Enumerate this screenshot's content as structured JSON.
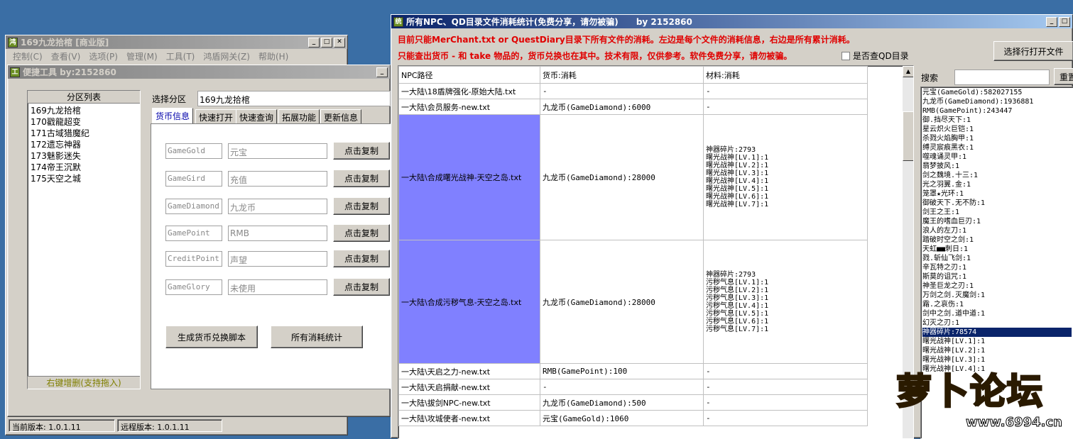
{
  "main_window": {
    "title": "169九龙拾棺 [商业版]",
    "menu": [
      "控制(C)",
      "查看(V)",
      "选项(P)",
      "管理(M)",
      "工具(T)",
      "鸿盾网关(Z)",
      "帮助(H)"
    ],
    "status_current": "当前版本: 1.0.1.11",
    "status_remote": "远程版本: 1.0.1.11"
  },
  "tools_window": {
    "title": "便捷工具  by:2152860",
    "partition_header": "分区列表",
    "partitions": [
      "169九龙拾棺",
      "170戳龍超变",
      "171古域猎魔纪",
      "172遗忘神器",
      "173魅影迷失",
      "174帝王沉默",
      "175天空之城"
    ],
    "partition_footer": "右键增删(支持拖入)",
    "select_label": "选择分区",
    "select_value": "169九龙拾棺",
    "tabs": [
      "货币信息",
      "快速打开",
      "快速查询",
      "拓展功能",
      "更新信息"
    ],
    "currencies": [
      {
        "code": "GameGold",
        "name": "元宝",
        "button": "点击复制"
      },
      {
        "code": "GameGird",
        "name": "充值",
        "button": "点击复制"
      },
      {
        "code": "GameDiamond",
        "name": "九龙币",
        "button": "点击复制"
      },
      {
        "code": "GamePoint",
        "name": "RMB",
        "button": "点击复制"
      },
      {
        "code": "CreditPoint",
        "name": "声望",
        "button": "点击复制"
      },
      {
        "code": "GameGlory",
        "name": "未使用",
        "button": "点击复制"
      }
    ],
    "gen_button": "生成货币兑换脚本",
    "stats_button": "所有消耗统计"
  },
  "stats_window": {
    "title": "所有NPC、QD目录文件消耗统计(免费分享，请勿被骗)      by 2152860",
    "notice1": "目前只能MerChant.txt or QuestDiary目录下所有文件的消耗。左边是每个文件的消耗信息，右边是所有累计消耗。",
    "notice2": "只能查出货币 - 和 take 物品的，货币兑换也在其中。技术有限，仅供参考。软件免费分享，请勿被骗。",
    "qd_checkbox": "是否查QD目录",
    "open_file_button": "选择行打开文件",
    "search_label": "搜索",
    "reset_button": "重置",
    "columns": [
      "NPC路径",
      "货币:消耗",
      "材料:消耗"
    ],
    "rows": [
      {
        "path": "一大陆\\18盾牌强化-原始大陆.txt",
        "currency": "-",
        "materials": [
          "-"
        ]
      },
      {
        "path": "一大陆\\会员服务-new.txt",
        "currency": "九龙币(GameDiamond):6000",
        "materials": [
          "-"
        ]
      },
      {
        "path": "一大陆\\合成曙光战神-天空之岛.txt",
        "currency": "九龙币(GameDiamond):28000",
        "materials": [
          "神器碎片:2793",
          "曙光战神[LV.1]:1",
          "曙光战神[LV.2]:1",
          "曙光战神[LV.3]:1",
          "曙光战神[LV.4]:1",
          "曙光战神[LV.5]:1",
          "曙光战神[LV.6]:1",
          "曙光战神[LV.7]:1"
        ]
      },
      {
        "path": "一大陆\\合成污秽气息-天空之岛.txt",
        "currency": "九龙币(GameDiamond):28000",
        "materials": [
          "神器碎片:2793",
          "污秽气息[LV.1]:1",
          "污秽气息[LV.2]:1",
          "污秽气息[LV.3]:1",
          "污秽气息[LV.4]:1",
          "污秽气息[LV.5]:1",
          "污秽气息[LV.6]:1",
          "污秽气息[LV.7]:1"
        ]
      },
      {
        "path": "一大陆\\天启之力-new.txt",
        "currency": "RMB(GamePoint):100",
        "materials": [
          "-"
        ]
      },
      {
        "path": "一大陆\\天启捐献-new.txt",
        "currency": "-",
        "materials": [
          "-"
        ]
      },
      {
        "path": "一大陆\\拔剑NPC-new.txt",
        "currency": "九龙币(GameDiamond):500",
        "materials": [
          "-"
        ]
      },
      {
        "path": "一大陆\\攻城使者-new.txt",
        "currency": "元宝(GameGold):1060",
        "materials": [
          "-"
        ]
      }
    ],
    "totals": [
      "元宝(GameGold):582027155",
      "九龙币(GameDiamond):1936881",
      "RMB(GamePoint):243447",
      "御.挡尽天下:1",
      "星云炽火巨铠:1",
      "杀戮火焰胸甲:1",
      "缚灵宸痕黑衣:1",
      "噬魂诵灵甲:1",
      "翡梦披风:1",
      "剑之魏境.十三:1",
      "光之羽翼.金:1",
      "笼罩★光环:1",
      "御破天下.无不防:1",
      "剑王之王:1",
      "魔王的嗜血巨刃:1",
      "浪人的左刀:1",
      "踏破时空之剑:1",
      "天虹■■刺日:1",
      "戮.斩仙飞剑:1",
      "辛瓦特之刃:1",
      "斯莫的诅咒:1",
      "神圣巨龙之刃:1",
      "万剑之剑.灭魔剑:1",
      "霜.之哀伤:1",
      "剑中之剑.道中道:1",
      "幻灭之刃:1",
      "神器碎片:78574",
      "曙光战神[LV.1]:1",
      "曙光战神[LV.2]:1",
      "曙光战神[LV.3]:1",
      "曙光战神[LV.4]:1"
    ],
    "selected_total_index": 26
  },
  "watermark": {
    "text": "萝卜论坛",
    "url": "www.6994.cn"
  }
}
